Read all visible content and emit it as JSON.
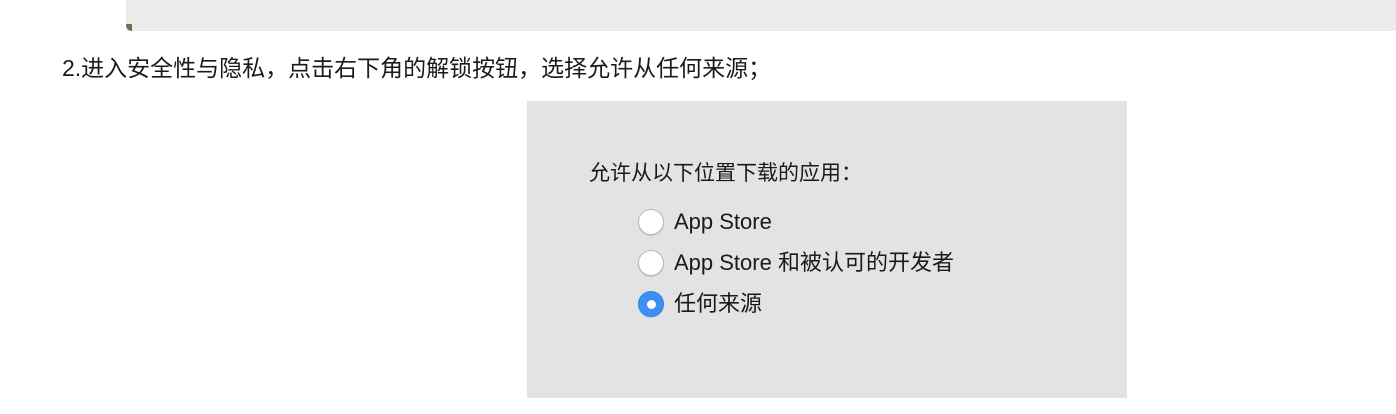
{
  "instruction": {
    "step_text": "2.进入安全性与隐私，点击右下角的解锁按钮，选择允许从任何来源；"
  },
  "settings_panel": {
    "heading": "允许从以下位置下载的应用：",
    "options": [
      {
        "label": "App Store",
        "selected": false
      },
      {
        "label": "App Store 和被认可的开发者",
        "selected": false
      },
      {
        "label": "任何来源",
        "selected": true
      }
    ]
  },
  "colors": {
    "radio_selected": "#3d8ff5",
    "panel_background": "#e3e3e3"
  }
}
